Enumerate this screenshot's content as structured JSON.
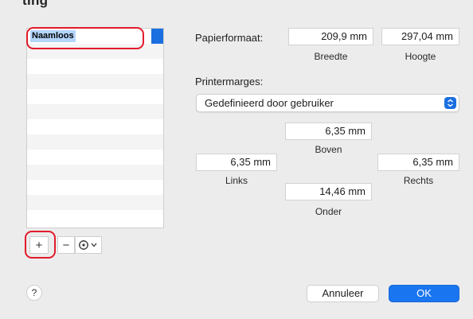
{
  "header": {
    "title_fragment": "ting"
  },
  "sizes_list": {
    "items": [
      {
        "name": "Naamloos",
        "selected": true
      }
    ],
    "empty_rows": 12
  },
  "list_controls": {
    "add_label": "+",
    "remove_label": "−",
    "action_icon": "gear-icon"
  },
  "paper_size": {
    "label": "Papierformaat:",
    "width_value": "209,9 mm",
    "width_caption": "Breedte",
    "height_value": "297,04 mm",
    "height_caption": "Hoogte"
  },
  "margins": {
    "label": "Printermarges:",
    "preset": "Gedefinieerd door gebruiker",
    "top_value": "6,35 mm",
    "top_caption": "Boven",
    "left_value": "6,35 mm",
    "left_caption": "Links",
    "right_value": "6,35 mm",
    "right_caption": "Rechts",
    "bottom_value": "14,46 mm",
    "bottom_caption": "Onder"
  },
  "footer": {
    "help_label": "?",
    "cancel_label": "Annuleer",
    "ok_label": "OK"
  },
  "colors": {
    "accent": "#1a75f0",
    "highlight": "#e21b2b",
    "selection": "#b3d5fb"
  }
}
